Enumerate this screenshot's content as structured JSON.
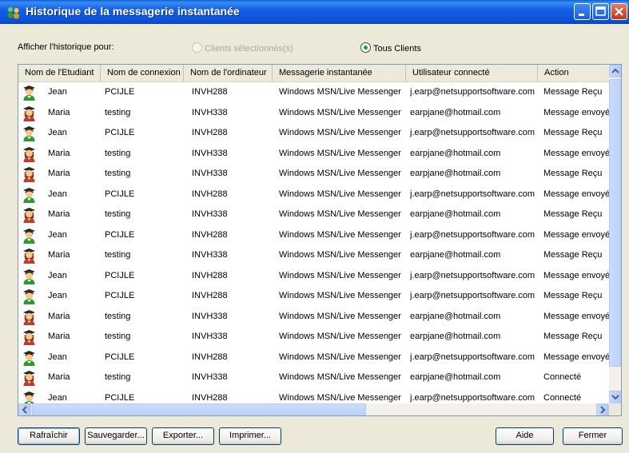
{
  "window": {
    "title": "Historique de la messagerie instantanée",
    "icon": "users-icon"
  },
  "filter": {
    "label": "Afficher l'historique pour:",
    "options": [
      {
        "label": "Clients sélectionnés(s)",
        "selected": false,
        "enabled": false
      },
      {
        "label": "Tous Clients",
        "selected": true,
        "enabled": true
      }
    ]
  },
  "table": {
    "columns": [
      "Nom de l'Etudiant",
      "Nom de connexion",
      "Nom de l'ordinateur",
      "Messagerie instantanée",
      "Utilisateur connecté",
      "Action"
    ],
    "rows": [
      {
        "student": "Jean",
        "login": "PCIJLE",
        "computer": "INVH288",
        "im": "Windows MSN/Live Messenger",
        "user": "j.earp@netsupportsoftware.com",
        "action": "Message Reçu",
        "avatar": "male-student-icon"
      },
      {
        "student": "Maria",
        "login": "testing",
        "computer": "INVH338",
        "im": "Windows MSN/Live Messenger",
        "user": "earpjane@hotmail.com",
        "action": "Message envoyé",
        "avatar": "female-student-icon"
      },
      {
        "student": "Jean",
        "login": "PCIJLE",
        "computer": "INVH288",
        "im": "Windows MSN/Live Messenger",
        "user": "j.earp@netsupportsoftware.com",
        "action": "Message Reçu",
        "avatar": "male-student-icon"
      },
      {
        "student": "Maria",
        "login": "testing",
        "computer": "INVH338",
        "im": "Windows MSN/Live Messenger",
        "user": "earpjane@hotmail.com",
        "action": "Message envoyé",
        "avatar": "female-student-icon"
      },
      {
        "student": "Maria",
        "login": "testing",
        "computer": "INVH338",
        "im": "Windows MSN/Live Messenger",
        "user": "earpjane@hotmail.com",
        "action": "Message Reçu",
        "avatar": "female-student-icon"
      },
      {
        "student": "Jean",
        "login": "PCIJLE",
        "computer": "INVH288",
        "im": "Windows MSN/Live Messenger",
        "user": "j.earp@netsupportsoftware.com",
        "action": "Message envoyé",
        "avatar": "male-student-icon"
      },
      {
        "student": "Maria",
        "login": "testing",
        "computer": "INVH338",
        "im": "Windows MSN/Live Messenger",
        "user": "earpjane@hotmail.com",
        "action": "Message Reçu",
        "avatar": "female-student-icon"
      },
      {
        "student": "Jean",
        "login": "PCIJLE",
        "computer": "INVH288",
        "im": "Windows MSN/Live Messenger",
        "user": "j.earp@netsupportsoftware.com",
        "action": "Message envoyé",
        "avatar": "male-student-icon"
      },
      {
        "student": "Maria",
        "login": "testing",
        "computer": "INVH338",
        "im": "Windows MSN/Live Messenger",
        "user": "earpjane@hotmail.com",
        "action": "Message Reçu",
        "avatar": "female-student-icon"
      },
      {
        "student": "Jean",
        "login": "PCIJLE",
        "computer": "INVH288",
        "im": "Windows MSN/Live Messenger",
        "user": "j.earp@netsupportsoftware.com",
        "action": "Message envoyé",
        "avatar": "male-student-icon"
      },
      {
        "student": "Jean",
        "login": "PCIJLE",
        "computer": "INVH288",
        "im": "Windows MSN/Live Messenger",
        "user": "j.earp@netsupportsoftware.com",
        "action": "Message Reçu",
        "avatar": "male-student-icon"
      },
      {
        "student": "Maria",
        "login": "testing",
        "computer": "INVH338",
        "im": "Windows MSN/Live Messenger",
        "user": "earpjane@hotmail.com",
        "action": "Message envoyé",
        "avatar": "female-student-icon"
      },
      {
        "student": "Maria",
        "login": "testing",
        "computer": "INVH338",
        "im": "Windows MSN/Live Messenger",
        "user": "earpjane@hotmail.com",
        "action": "Message Reçu",
        "avatar": "female-student-icon"
      },
      {
        "student": "Jean",
        "login": "PCIJLE",
        "computer": "INVH288",
        "im": "Windows MSN/Live Messenger",
        "user": "j.earp@netsupportsoftware.com",
        "action": "Message envoyé",
        "avatar": "male-student-icon"
      },
      {
        "student": "Maria",
        "login": "testing",
        "computer": "INVH338",
        "im": "Windows MSN/Live Messenger",
        "user": "earpjane@hotmail.com",
        "action": "Connecté",
        "avatar": "female-student-icon"
      },
      {
        "student": "Jean",
        "login": "PCIJLE",
        "computer": "INVH288",
        "im": "Windows MSN/Live Messenger",
        "user": "j.earp@netsupportsoftware.com",
        "action": "Connecté",
        "avatar": "male-student-icon"
      }
    ]
  },
  "buttons": {
    "refresh": "Rafraîchir",
    "save": "Sauvegarder...",
    "export": "Exporter...",
    "print": "Imprimer...",
    "help": "Aide",
    "close": "Fermer"
  },
  "colors": {
    "title_bar": "#1660e6",
    "close_button": "#c4361c",
    "window_bg": "#ece9d8",
    "selected_radio": "#21a121"
  }
}
